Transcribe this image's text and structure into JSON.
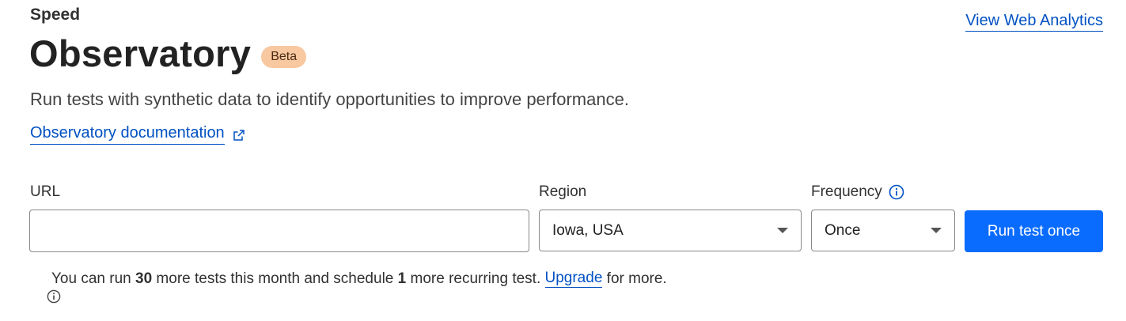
{
  "header": {
    "breadcrumb": "Speed",
    "title": "Observatory",
    "badge": "Beta",
    "top_link": "View Web Analytics",
    "subtitle": "Run tests with synthetic data to identify opportunities to improve performance.",
    "doc_link": "Observatory documentation"
  },
  "form": {
    "url_label": "URL",
    "url_value": "",
    "url_placeholder": "",
    "region_label": "Region",
    "region_value": "Iowa, USA",
    "frequency_label": "Frequency",
    "frequency_value": "Once",
    "run_button": "Run test once"
  },
  "notice": {
    "part1": "You can run ",
    "tests_count": "30",
    "part2": " more tests this month and schedule ",
    "recurring_count": "1",
    "part3": " more recurring test. ",
    "upgrade_link": "Upgrade",
    "part4": " for more."
  },
  "icons": {
    "external_link": "external-link-icon",
    "info_blue": "info-icon",
    "info_notice": "info-icon",
    "caret": "chevron-down-icon"
  },
  "colors": {
    "link": "#0051c3",
    "primary_button": "#0a6cff",
    "badge_bg": "#f8c8a0"
  }
}
